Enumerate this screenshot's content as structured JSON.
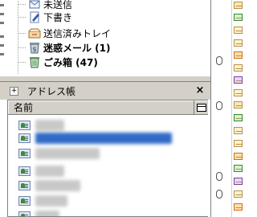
{
  "folders": [
    {
      "label": "未送信",
      "icon": "outbox-icon",
      "bold": false
    },
    {
      "label": "下書き",
      "icon": "drafts-icon",
      "bold": false
    },
    {
      "label": "送信済みトレイ",
      "icon": "sent-icon",
      "bold": false
    },
    {
      "label": "迷惑メール (1)",
      "icon": "junk-icon",
      "bold": true
    },
    {
      "label": "ごみ箱 (47)",
      "icon": "trash-icon",
      "bold": true
    }
  ],
  "address_book": {
    "title": "アドレス帳",
    "toggle_label": "+",
    "close_label": "×",
    "column_header": "名前",
    "contacts": [
      {
        "name": "██████",
        "selected": false
      },
      {
        "name": "████████████████",
        "selected": true
      },
      {
        "name": "███████████",
        "selected": false
      },
      {
        "name": "██████",
        "selected": false
      },
      {
        "name": "████████",
        "selected": false
      },
      {
        "name": "██████",
        "selected": false
      },
      {
        "name": "████",
        "selected": false
      }
    ]
  },
  "colors": {
    "selection": "#316ac5",
    "chrome": "#d4d0c8"
  }
}
